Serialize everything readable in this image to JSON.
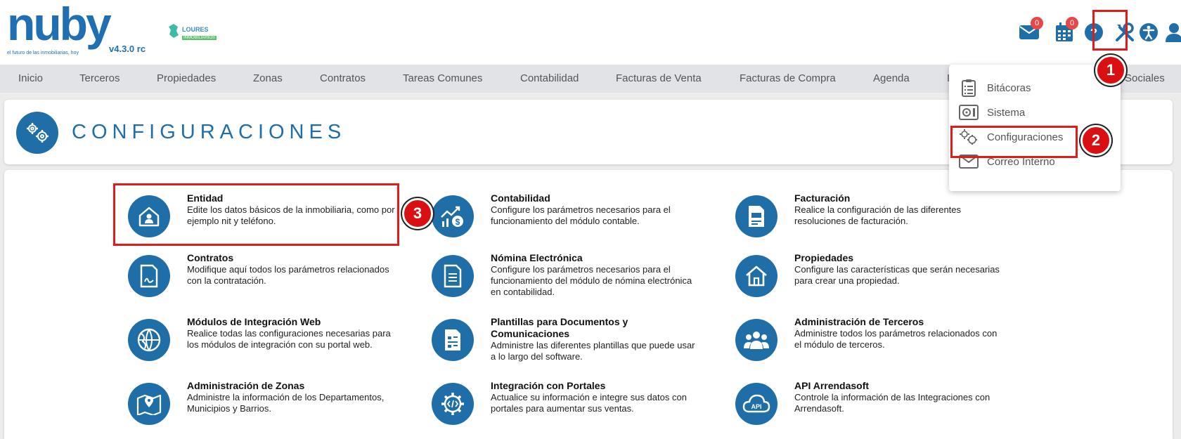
{
  "header": {
    "logo_text": "nuby",
    "logo_tagline": "el futuro de las inmobiliarias, hoy",
    "version": "v4.3.0 rc",
    "partner_name": "LOURES",
    "partner_sub": "INMOBILIARIOS",
    "mail_badge": "0",
    "calendar_badge": "0"
  },
  "nav": {
    "items": [
      "Inicio",
      "Terceros",
      "Propiedades",
      "Zonas",
      "Contratos",
      "Tareas Comunes",
      "Contabilidad",
      "Facturas de Venta",
      "Facturas de Compra",
      "Agenda",
      "I",
      "Sociales"
    ]
  },
  "page": {
    "title": "CONFIGURACIONES"
  },
  "tiles": [
    {
      "title": "Entidad",
      "desc": "Edite los datos básicos de la inmobiliaria, como por ejemplo nit y teléfono.",
      "icon": "house-user-icon"
    },
    {
      "title": "Contabilidad",
      "desc": "Configure los parámetros necesarios para el funcionamiento del módulo contable.",
      "icon": "accounting-chart-icon"
    },
    {
      "title": "Facturación",
      "desc": "Realice la configuración de las diferentes resoluciones de facturación.",
      "icon": "invoice-icon"
    },
    {
      "title": "Contratos",
      "desc": "Modifique aquí todos los parámetros relacionados con la contratación.",
      "icon": "contract-icon"
    },
    {
      "title": "Nómina Electrónica",
      "desc": "Configure los parámetros necesarios para el funcionamiento del módulo de nómina electrónica en contabilidad.",
      "icon": "payroll-document-icon"
    },
    {
      "title": "Propiedades",
      "desc": "Configure las características que serán necesarias para crear una propiedad.",
      "icon": "home-icon"
    },
    {
      "title": "Módulos de Integración Web",
      "desc": "Realice todas las configuraciones necesarias para los módulos de integración con su portal web.",
      "icon": "globe-icon"
    },
    {
      "title": "Plantillas para Documentos y Comunicaciones",
      "desc": "Administre las diferentes plantillas que puede usar a lo largo del software.",
      "icon": "template-document-icon"
    },
    {
      "title": "Administración de Terceros",
      "desc": "Administre todos los parámetros relacionados con el módulo de terceros.",
      "icon": "users-group-icon"
    },
    {
      "title": "Administración de Zonas",
      "desc": "Administre la información de los Departamentos, Municipios y Barrios.",
      "icon": "map-pin-icon"
    },
    {
      "title": "Integración con Portales",
      "desc": "Actualice su información e integre sus datos con portales para aumentar sus ventas.",
      "icon": "code-gear-icon"
    },
    {
      "title": "API Arrendasoft",
      "desc": "Controle la información de las Integraciones con Arrendasoft.",
      "icon": "api-cloud-icon"
    }
  ],
  "dropdown": {
    "items": [
      "Bitácoras",
      "Sistema",
      "Configuraciones",
      "Correo Interno"
    ]
  },
  "annotations": {
    "step1": "1",
    "step2": "2",
    "step3": "3"
  },
  "colors": {
    "primary": "#1f6ea8",
    "annotation": "#e01b1b"
  }
}
